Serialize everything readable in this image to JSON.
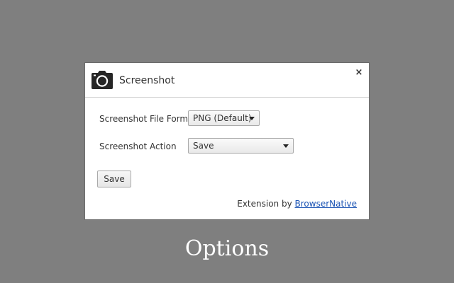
{
  "dialog": {
    "title": "Screenshot",
    "close_label": "×",
    "icon": "camera-icon"
  },
  "form": {
    "format_label": "Screenshot File Format",
    "format_value": "PNG (Default)",
    "action_label": "Screenshot Action",
    "action_value": "Save",
    "save_label": "Save"
  },
  "footer": {
    "credit_prefix": "Extension by",
    "credit_link": "BrowserNative"
  },
  "caption": "Options",
  "colors": {
    "background": "#7f7f7f",
    "dialog": "#ffffff",
    "link": "#1a53b4"
  }
}
